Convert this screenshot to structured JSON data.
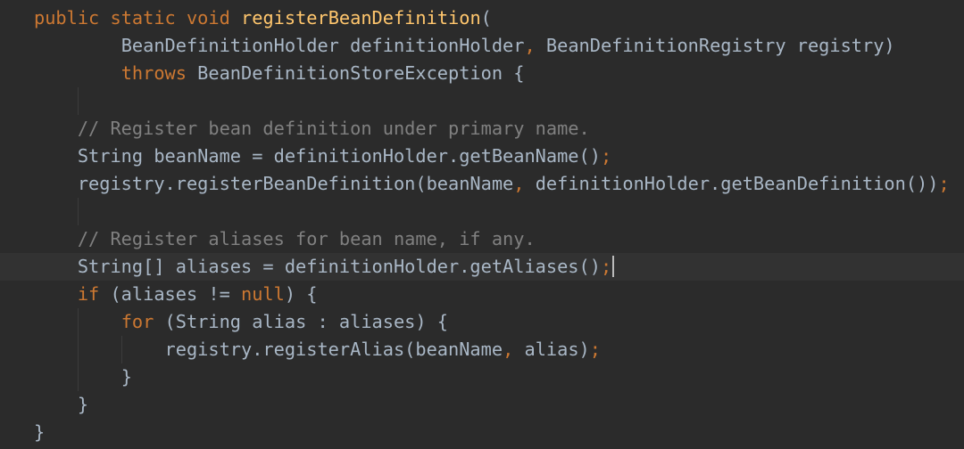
{
  "code": {
    "lines": [
      {
        "indent": 0,
        "guides": [],
        "segments": [
          {
            "t": "public",
            "k": "kw"
          },
          {
            "t": " ",
            "k": "id"
          },
          {
            "t": "static",
            "k": "kw"
          },
          {
            "t": " ",
            "k": "id"
          },
          {
            "t": "void",
            "k": "kw"
          },
          {
            "t": " ",
            "k": "id"
          },
          {
            "t": "registerBeanDefinition",
            "k": "fn"
          },
          {
            "t": "(",
            "k": "id"
          }
        ]
      },
      {
        "indent": 8,
        "guides": [],
        "segments": [
          {
            "t": "BeanDefinitionHolder definitionHolder",
            "k": "id"
          },
          {
            "t": ",",
            "k": "kw"
          },
          {
            "t": " BeanDefinitionRegistry registry)",
            "k": "id"
          }
        ]
      },
      {
        "indent": 8,
        "guides": [],
        "segments": [
          {
            "t": "throws",
            "k": "kw"
          },
          {
            "t": " BeanDefinitionStoreException {",
            "k": "id"
          }
        ]
      },
      {
        "indent": 0,
        "guides": [
          4
        ],
        "segments": []
      },
      {
        "indent": 4,
        "guides": [],
        "segments": [
          {
            "t": "// Register bean definition under primary name.",
            "k": "cm"
          }
        ]
      },
      {
        "indent": 4,
        "guides": [],
        "segments": [
          {
            "t": "String beanName = definitionHolder.getBeanName()",
            "k": "id"
          },
          {
            "t": ";",
            "k": "kw"
          }
        ]
      },
      {
        "indent": 4,
        "guides": [],
        "segments": [
          {
            "t": "registry.registerBeanDefinition(beanName",
            "k": "id"
          },
          {
            "t": ",",
            "k": "kw"
          },
          {
            "t": " definitionHolder.getBeanDefinition())",
            "k": "id"
          },
          {
            "t": ";",
            "k": "kw"
          }
        ]
      },
      {
        "indent": 0,
        "guides": [
          4
        ],
        "segments": []
      },
      {
        "indent": 4,
        "guides": [],
        "segments": [
          {
            "t": "// Register aliases for bean name, if any.",
            "k": "cm"
          }
        ]
      },
      {
        "indent": 4,
        "guides": [],
        "current": true,
        "cursor": true,
        "segments": [
          {
            "t": "String[] aliases = definitionHolder.getAliases()",
            "k": "id"
          },
          {
            "t": ";",
            "k": "kw"
          }
        ]
      },
      {
        "indent": 4,
        "guides": [],
        "segments": [
          {
            "t": "if",
            "k": "kw"
          },
          {
            "t": " (aliases != ",
            "k": "id"
          },
          {
            "t": "null",
            "k": "kw"
          },
          {
            "t": ") {",
            "k": "id"
          }
        ]
      },
      {
        "indent": 8,
        "guides": [
          4
        ],
        "segments": [
          {
            "t": "for",
            "k": "kw"
          },
          {
            "t": " (String alias : aliases) {",
            "k": "id"
          }
        ]
      },
      {
        "indent": 12,
        "guides": [
          4,
          8
        ],
        "segments": [
          {
            "t": "registry.registerAlias(beanName",
            "k": "id"
          },
          {
            "t": ",",
            "k": "kw"
          },
          {
            "t": " alias)",
            "k": "id"
          },
          {
            "t": ";",
            "k": "kw"
          }
        ]
      },
      {
        "indent": 8,
        "guides": [
          4
        ],
        "segments": [
          {
            "t": "}",
            "k": "id"
          }
        ]
      },
      {
        "indent": 4,
        "guides": [],
        "segments": [
          {
            "t": "}",
            "k": "id"
          }
        ]
      },
      {
        "indent": 0,
        "guides": [],
        "segments": [
          {
            "t": "}",
            "k": "id"
          }
        ]
      }
    ]
  },
  "colors": {
    "background": "#2b2b2b",
    "keyword": "#cc7832",
    "method_declaration": "#ffc66d",
    "comment": "#808080",
    "identifier": "#a9b7c6",
    "current_line": "#323232"
  }
}
